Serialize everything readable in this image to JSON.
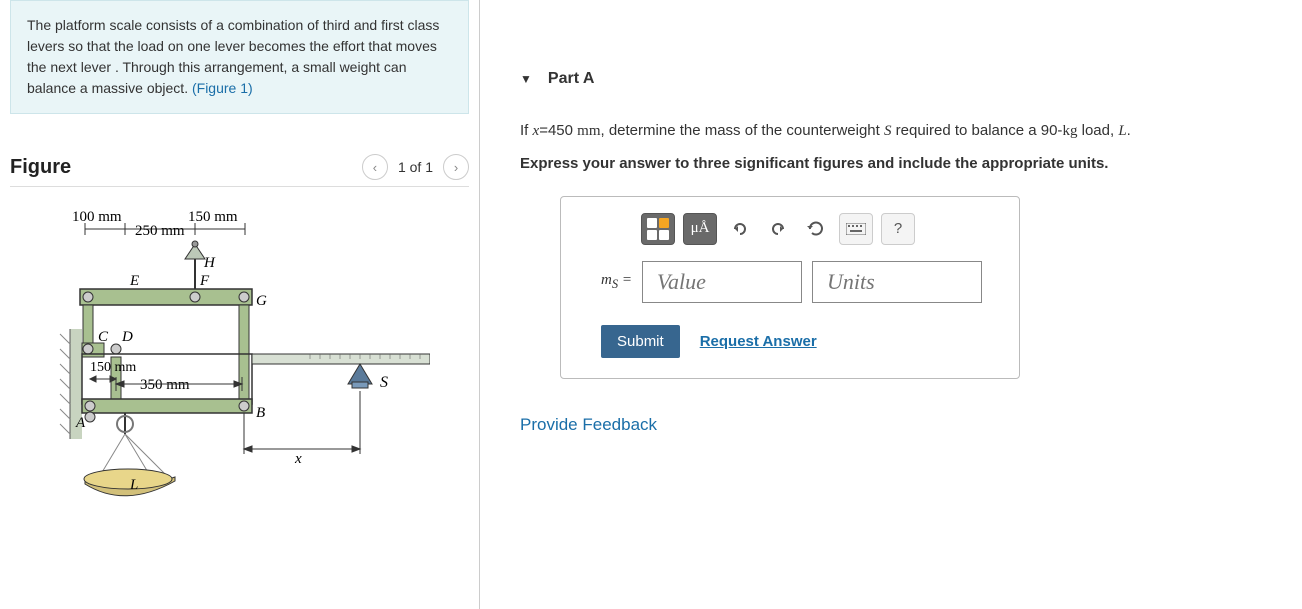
{
  "problem": {
    "text_before_link": "The platform scale consists of a combination of third and first class levers so that the load on one lever becomes the effort that moves the next lever . Through this arrangement, a small weight can balance a massive object. ",
    "link_text": "(Figure 1)"
  },
  "figure": {
    "title": "Figure",
    "nav_text": "1 of 1",
    "labels": {
      "d100": "100 mm",
      "d250": "250 mm",
      "d150": "150 mm",
      "d150_2": "150 mm",
      "d350": "350 mm",
      "H": "H",
      "E": "E",
      "F": "F",
      "G": "G",
      "C": "C",
      "D": "D",
      "A": "A",
      "B": "B",
      "S": "S",
      "L": "L",
      "x": "x"
    }
  },
  "part": {
    "title": "Part A",
    "question_prefix": "If ",
    "question_var": "x",
    "question_eq": "=450 ",
    "question_unit": "mm",
    "question_mid": ", determine the mass of the counterweight ",
    "question_S": "S",
    "question_mid2": " required to balance a 90-",
    "question_kg": "kg",
    "question_mid3": " load, ",
    "question_L": "L",
    "question_end": ".",
    "instructions": "Express your answer to three significant figures and include the appropriate units."
  },
  "answer": {
    "var_label": "m",
    "var_sub": "S",
    "equals": " = ",
    "value_placeholder": "Value",
    "units_placeholder": "Units",
    "submit": "Submit",
    "request": "Request Answer",
    "tool_mu": "μÅ",
    "tool_help": "?"
  },
  "feedback": "Provide Feedback"
}
